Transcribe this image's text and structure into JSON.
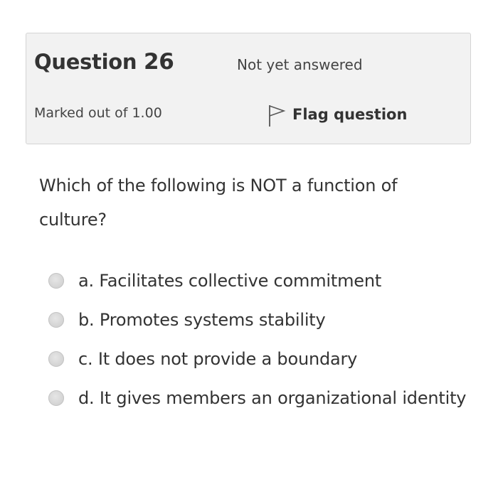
{
  "question": {
    "title_prefix": "Question",
    "number": "26",
    "state": "Not yet answered",
    "grade": "Marked out of 1.00",
    "flag_label": "Flag question",
    "text": "Which of the following is NOT a function of culture?"
  },
  "answers": [
    {
      "letter": "a.",
      "text": "Facilitates collective commitment",
      "selected": false
    },
    {
      "letter": "b.",
      "text": "Promotes systems stability",
      "selected": false
    },
    {
      "letter": "c.",
      "text": "It does not provide a boundary",
      "selected": false
    },
    {
      "letter": "d.",
      "text": "It gives members an organizational identity",
      "selected": false
    }
  ],
  "icons": {
    "flag": "flag-icon",
    "radio": "radio-icon"
  },
  "colors": {
    "info_background": "#f2f2f2",
    "info_border": "#d4d4d4",
    "text": "#333333",
    "radio": "#d2d2d2"
  }
}
